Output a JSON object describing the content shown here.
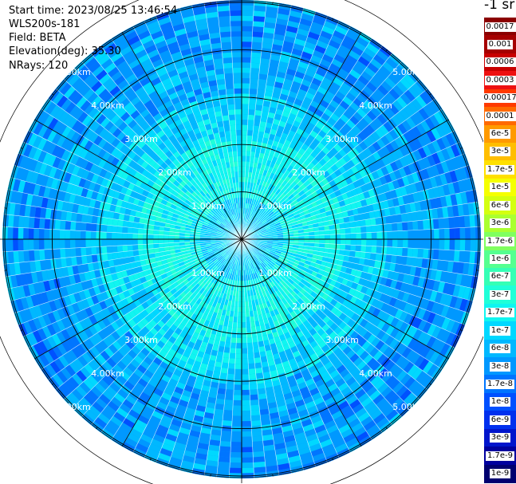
{
  "info": {
    "start_time": "Start time: 2023/08/25 13:46:54",
    "instrument": "WLS200s-181",
    "field": "Field: BETA",
    "elevation": "Elevation(deg): 35.30",
    "nrays": "NRays: 120"
  },
  "colorbar": {
    "title": "-1 sr",
    "items": [
      {
        "label": "0.0017",
        "color": "#8b0000"
      },
      {
        "label": "0.001",
        "color": "#a50000"
      },
      {
        "label": "0.0006",
        "color": "#c80000"
      },
      {
        "label": "0.0003",
        "color": "#ee1010"
      },
      {
        "label": "0.00017",
        "color": "#ff3a00"
      },
      {
        "label": "0.0001",
        "color": "#ff6a00"
      },
      {
        "label": "6e-5",
        "color": "#ff9a00"
      },
      {
        "label": "3e-5",
        "color": "#ffbe00"
      },
      {
        "label": "1.7e-5",
        "color": "#ffe000"
      },
      {
        "label": "1e-5",
        "color": "#f5ff00"
      },
      {
        "label": "6e-6",
        "color": "#d4ff10"
      },
      {
        "label": "3e-6",
        "color": "#aaff30"
      },
      {
        "label": "1.7e-6",
        "color": "#80ff60"
      },
      {
        "label": "1e-6",
        "color": "#55ff90"
      },
      {
        "label": "6e-7",
        "color": "#35ffb5"
      },
      {
        "label": "3e-7",
        "color": "#20ffd8"
      },
      {
        "label": "1.7e-7",
        "color": "#10f5f0"
      },
      {
        "label": "1e-7",
        "color": "#00d8ff"
      },
      {
        "label": "6e-8",
        "color": "#00b8ff"
      },
      {
        "label": "3e-8",
        "color": "#0098ff"
      },
      {
        "label": "1.7e-8",
        "color": "#0075ff"
      },
      {
        "label": "1e-8",
        "color": "#0050ff"
      },
      {
        "label": "6e-9",
        "color": "#0030ee"
      },
      {
        "label": "3e-9",
        "color": "#0015cc"
      },
      {
        "label": "1.7e-9",
        "color": "#00009e"
      },
      {
        "label": "1e-9",
        "color": "#000070"
      }
    ]
  },
  "range_rings": {
    "labels": [
      "1.00km",
      "2.00km",
      "3.00km",
      "4.00km",
      "5.00km"
    ],
    "max_km": 5.0
  },
  "scan": {
    "spokes": 12,
    "sector_lines": 4
  }
}
